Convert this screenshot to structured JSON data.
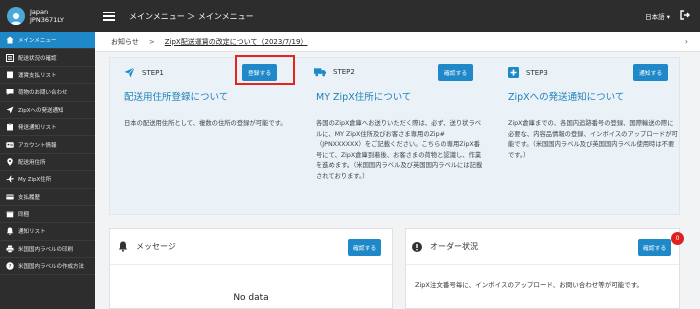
{
  "user": {
    "country": "Japan",
    "id": "JPN3671LY"
  },
  "sidebar": {
    "items": [
      {
        "label": "メインメニュー",
        "icon": "home-icon"
      },
      {
        "label": "配送状況の確認",
        "icon": "list-icon"
      },
      {
        "label": "運賃支払リスト",
        "icon": "receipt-icon"
      },
      {
        "label": "荷物のお問い合わせ",
        "icon": "chat-icon"
      },
      {
        "label": "ZipXへの発送通知",
        "icon": "send-icon"
      },
      {
        "label": "発送通知リスト",
        "icon": "clipboard-icon"
      },
      {
        "label": "アカウント情報",
        "icon": "id-card-icon"
      },
      {
        "label": "配送用住所",
        "icon": "pin-icon"
      },
      {
        "label": "My ZipX住所",
        "icon": "plane-icon"
      },
      {
        "label": "支払履歴",
        "icon": "card-icon"
      },
      {
        "label": "同梱",
        "icon": "box-icon"
      },
      {
        "label": "通知リスト",
        "icon": "bell-icon"
      },
      {
        "label": "米国国内ラベルの印刷",
        "icon": "printer-icon"
      },
      {
        "label": "米国国内ラベルの作成方法",
        "icon": "help-icon"
      }
    ]
  },
  "topbar": {
    "breadcrumb": "メインメニュー ＞ メインメニュー",
    "language": "日本語 ▾"
  },
  "notice": {
    "label": "お知らせ",
    "separator": ">",
    "link": "ZipX配送運賃の改定について（2023/7/19）",
    "arrow": "›"
  },
  "steps": [
    {
      "num": "STEP1",
      "button": "登録する",
      "title": "配送用住所登録について",
      "desc": "日本の配送用住所として、複数の住所の登録が可能です。",
      "icon": "send-icon"
    },
    {
      "num": "STEP2",
      "button": "確認する",
      "title": "MY ZipX住所について",
      "desc": "各国のZipX倉庫へお送りいただく際は、必ず、送り状ラベルに、MY ZipX住所及びお客さま専用のZip#（JPNXXXXXX）をご記載ください。こちらの専用ZipX番号にて、ZipX倉庫到着後、お客さまの荷物と認識し、作業を進めます。（米国国内ラベル及び英国国内ラベルには記載されております。）",
      "icon": "truck-icon"
    },
    {
      "num": "STEP3",
      "button": "通知する",
      "title": "ZipXへの発送通知について",
      "desc": "ZipX倉庫までの、各国内追跡番号の登録、国際輸送の際に必要な、内容品情報の登録、インボイスのアップロードが可能です。（米国国内ラベル及び英国国内ラベル使用時は不要です。）",
      "icon": "plus-square-icon"
    }
  ],
  "message_card": {
    "title": "メッセージ",
    "button": "確認する",
    "empty": "No data"
  },
  "order_card": {
    "title": "オーダー状況",
    "button": "確認する",
    "badge": "0",
    "desc": "ZipX注文番号毎に、インボイスのアップロード、お問い合わせ等が可能です。"
  },
  "colors": {
    "accent": "#1e88c9",
    "sidebar_bg": "#2d2d2d",
    "highlight": "#e5241d",
    "badge": "#e02020"
  }
}
